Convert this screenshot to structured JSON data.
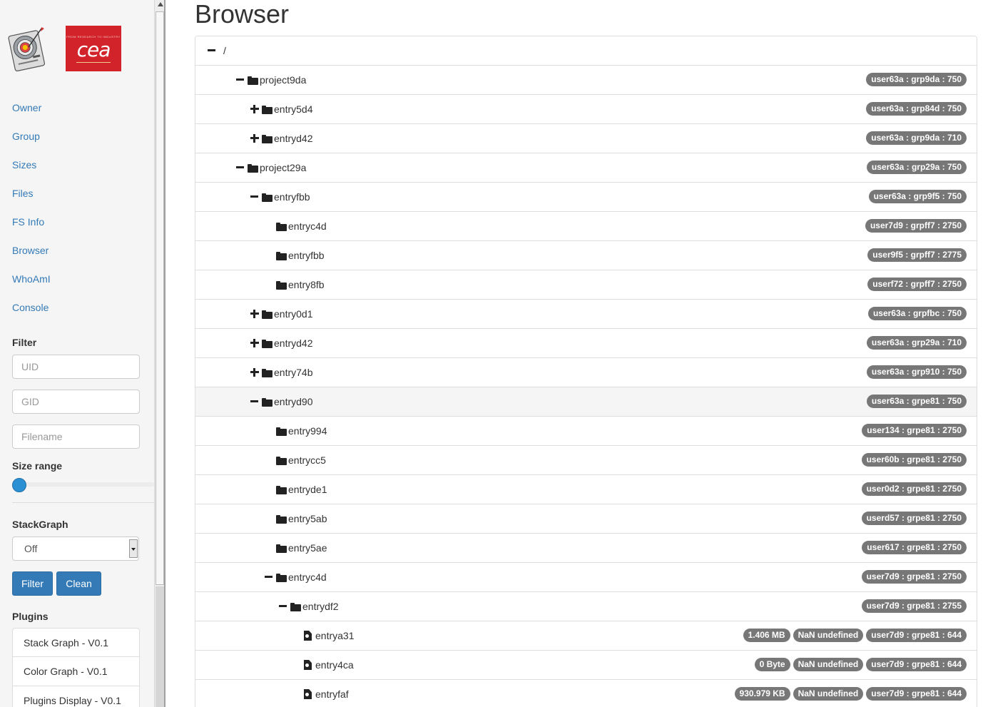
{
  "sidebar": {
    "logo_text": "cea",
    "logo_tagline": "FROM RESEARCH TO INDUSTRY",
    "nav": [
      "Owner",
      "Group",
      "Sizes",
      "Files",
      "FS Info",
      "Browser",
      "WhoAmI",
      "Console"
    ],
    "filter_label": "Filter",
    "uid_placeholder": "UID",
    "gid_placeholder": "GID",
    "filename_placeholder": "Filename",
    "size_range_label": "Size range",
    "size_range_value": 0,
    "stackgraph_label": "StackGraph",
    "stackgraph_value": "Off",
    "filter_button": "Filter",
    "clean_button": "Clean",
    "plugins_label": "Plugins",
    "plugins": [
      "Stack Graph - V0.1",
      "Color Graph - V0.1",
      "Plugins Display - V0.1"
    ]
  },
  "main": {
    "title": "Browser",
    "root": "/",
    "rows": [
      {
        "depth": 1,
        "toggle": "minus",
        "kind": "folder",
        "name": "project9da",
        "badges": [
          "user63a : grp9da : 750"
        ]
      },
      {
        "depth": 2,
        "toggle": "plus",
        "kind": "folder",
        "name": "entry5d4",
        "badges": [
          "user63a : grp84d : 750"
        ]
      },
      {
        "depth": 2,
        "toggle": "plus",
        "kind": "folder",
        "name": "entryd42",
        "badges": [
          "user63a : grp9da : 710"
        ]
      },
      {
        "depth": 1,
        "toggle": "minus",
        "kind": "folder",
        "name": "project29a",
        "badges": [
          "user63a : grp29a : 750"
        ]
      },
      {
        "depth": 2,
        "toggle": "minus",
        "kind": "folder",
        "name": "entryfbb",
        "badges": [
          "user63a : grp9f5 : 750"
        ]
      },
      {
        "depth": 3,
        "toggle": "none",
        "kind": "folder",
        "name": "entryc4d",
        "badges": [
          "user7d9 : grpff7 : 2750"
        ]
      },
      {
        "depth": 3,
        "toggle": "none",
        "kind": "folder",
        "name": "entryfbb",
        "badges": [
          "user9f5 : grpff7 : 2775"
        ]
      },
      {
        "depth": 3,
        "toggle": "none",
        "kind": "folder",
        "name": "entry8fb",
        "badges": [
          "userf72 : grpff7 : 2750"
        ]
      },
      {
        "depth": 2,
        "toggle": "plus",
        "kind": "folder",
        "name": "entry0d1",
        "badges": [
          "user63a : grpfbc : 750"
        ]
      },
      {
        "depth": 2,
        "toggle": "plus",
        "kind": "folder",
        "name": "entryd42",
        "badges": [
          "user63a : grp29a : 710"
        ]
      },
      {
        "depth": 2,
        "toggle": "plus",
        "kind": "folder",
        "name": "entry74b",
        "badges": [
          "user63a : grp910 : 750"
        ]
      },
      {
        "depth": 2,
        "toggle": "minus",
        "kind": "folder",
        "name": "entryd90",
        "badges": [
          "user63a : grpe81 : 750"
        ],
        "highlight": true
      },
      {
        "depth": 3,
        "toggle": "none",
        "kind": "folder",
        "name": "entry994",
        "badges": [
          "user134 : grpe81 : 2750"
        ]
      },
      {
        "depth": 3,
        "toggle": "none",
        "kind": "folder",
        "name": "entrycc5",
        "badges": [
          "user60b : grpe81 : 2750"
        ]
      },
      {
        "depth": 3,
        "toggle": "none",
        "kind": "folder",
        "name": "entryde1",
        "badges": [
          "user0d2 : grpe81 : 2750"
        ]
      },
      {
        "depth": 3,
        "toggle": "none",
        "kind": "folder",
        "name": "entry5ab",
        "badges": [
          "userd57 : grpe81 : 2750"
        ]
      },
      {
        "depth": 3,
        "toggle": "none",
        "kind": "folder",
        "name": "entry5ae",
        "badges": [
          "user617 : grpe81 : 2750"
        ]
      },
      {
        "depth": 3,
        "toggle": "minus",
        "kind": "folder",
        "name": "entryc4d",
        "badges": [
          "user7d9 : grpe81 : 2750"
        ]
      },
      {
        "depth": 4,
        "toggle": "minus",
        "kind": "folder",
        "name": "entrydf2",
        "badges": [
          "user7d9 : grpe81 : 2755"
        ]
      },
      {
        "depth": 5,
        "toggle": "none",
        "kind": "file",
        "name": "entrya31",
        "badges": [
          "1.406 MB",
          "NaN undefined",
          "user7d9 : grpe81 : 644"
        ]
      },
      {
        "depth": 5,
        "toggle": "none",
        "kind": "file",
        "name": "entry4ca",
        "badges": [
          "0 Byte",
          "NaN undefined",
          "user7d9 : grpe81 : 644"
        ]
      },
      {
        "depth": 5,
        "toggle": "none",
        "kind": "file",
        "name": "entryfaf",
        "badges": [
          "930.979 KB",
          "NaN undefined",
          "user7d9 : grpe81 : 644"
        ]
      }
    ]
  },
  "colors": {
    "link": "#337ab7",
    "badge": "#777777",
    "brand_red": "#d2232a",
    "slider": "#2b8fd4"
  }
}
